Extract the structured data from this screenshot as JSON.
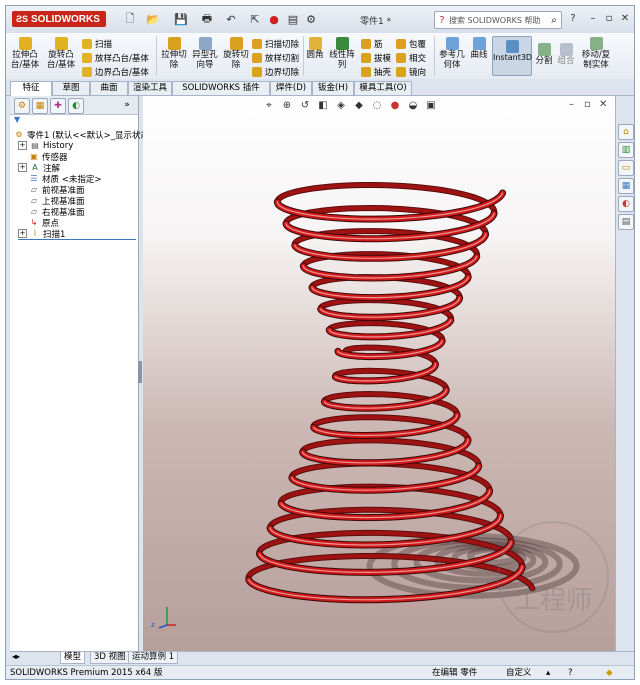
{
  "app": {
    "brand": "SOLIDWORKS",
    "document_title": "零件1 *"
  },
  "search": {
    "placeholder": "搜索 SOLIDWORKS 帮助"
  },
  "commands": {
    "extrude_boss": "拉伸凸\n台/基体",
    "revolve_boss": "旋转凸\n台/基体",
    "sweep": "扫描",
    "loft": "放样凸台/基体",
    "boundary_boss": "边界凸台/基体",
    "extrude_cut": "拉伸切\n除",
    "hole_wizard": "异型孔\n向导",
    "revolve_cut": "旋转切\n除",
    "swept_cut": "扫描切除",
    "lofted_cut": "放样切割",
    "boundary_cut": "边界切除",
    "fillet": "圆角",
    "linear_pattern": "线性阵\n列",
    "rib": "筋",
    "draft": "拔模",
    "shell": "抽壳",
    "wrap": "包覆",
    "intersect": "相交",
    "mirror": "镜向",
    "ref_geometry": "参考几\n何体",
    "curves": "曲线",
    "instant3d": "Instant3D",
    "split": "分割",
    "combine": "组合",
    "move_copy": "移动/复\n制实体"
  },
  "tabs": [
    "特征",
    "草图",
    "曲面",
    "渲染工具",
    "SOLIDWORKS 插件",
    "焊件(D)",
    "钣金(H)",
    "模具工具(O)"
  ],
  "tree": {
    "root": "零件1 (默认<<默认>_显示状态",
    "items": [
      {
        "label": "History",
        "expandable": true
      },
      {
        "label": "传感器",
        "expandable": false
      },
      {
        "label": "注解",
        "expandable": true
      },
      {
        "label": "材质 <未指定>",
        "expandable": false
      },
      {
        "label": "前视基准面",
        "expandable": false
      },
      {
        "label": "上视基准面",
        "expandable": false
      },
      {
        "label": "右视基准面",
        "expandable": false
      },
      {
        "label": "原点",
        "expandable": false
      },
      {
        "label": "扫描1",
        "expandable": true
      }
    ]
  },
  "bottom_tabs": [
    "模型",
    "3D 视图",
    "运动算例 1"
  ],
  "status": {
    "product": "SOLIDWORKS Premium 2015 x64 版",
    "mode": "在编辑 零件",
    "units": "自定义"
  },
  "watermark": "工程师",
  "colors": {
    "spring": "#d01818",
    "brand": "#c9261b",
    "accent": "#3a78c2"
  },
  "icons": [
    "solidworks-logo-icon",
    "new-icon",
    "open-icon",
    "save-icon",
    "print-icon",
    "undo-icon",
    "select-icon",
    "rebuild-icon",
    "options-icon",
    "help-icon",
    "minimize-icon",
    "restore-icon",
    "close-icon"
  ]
}
